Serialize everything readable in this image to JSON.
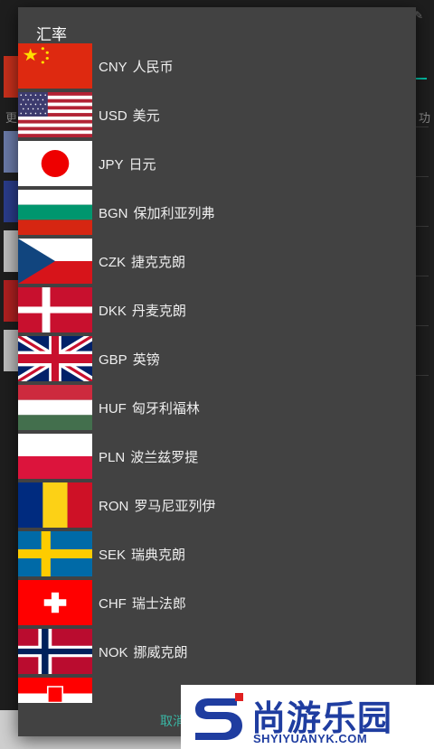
{
  "dialog": {
    "title": "汇率",
    "cancel_label": "取消"
  },
  "currencies": [
    {
      "code": "CNY",
      "name": "人民币",
      "flag": "china-flag"
    },
    {
      "code": "USD",
      "name": "美元",
      "flag": "usa-flag"
    },
    {
      "code": "JPY",
      "name": "日元",
      "flag": "japan-flag"
    },
    {
      "code": "BGN",
      "name": "保加利亚列弗",
      "flag": "bulgaria-flag"
    },
    {
      "code": "CZK",
      "name": "捷克克朗",
      "flag": "czech-flag"
    },
    {
      "code": "DKK",
      "name": "丹麦克朗",
      "flag": "denmark-flag"
    },
    {
      "code": "GBP",
      "name": "英镑",
      "flag": "uk-flag"
    },
    {
      "code": "HUF",
      "name": "匈牙利福林",
      "flag": "hungary-flag"
    },
    {
      "code": "PLN",
      "name": "波兰兹罗提",
      "flag": "poland-flag"
    },
    {
      "code": "RON",
      "name": "罗马尼亚列伊",
      "flag": "romania-flag"
    },
    {
      "code": "SEK",
      "name": "瑞典克朗",
      "flag": "sweden-flag"
    },
    {
      "code": "CHF",
      "name": "瑞士法郎",
      "flag": "switzerland-flag"
    },
    {
      "code": "NOK",
      "name": "挪威克朗",
      "flag": "norway-flag"
    }
  ],
  "background": {
    "left_text": "更",
    "right_text": "功"
  },
  "watermark": {
    "name": "尚游乐园",
    "url": "SHYIYUANYK.COM"
  },
  "colors": {
    "dialog_bg": "#424242",
    "accent": "#39b6a4",
    "watermark_blue": "#1f3da0"
  }
}
